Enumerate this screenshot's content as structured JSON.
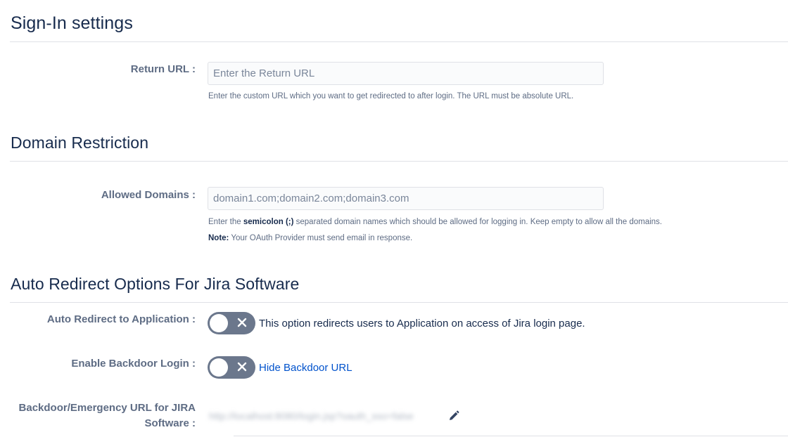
{
  "sign_in": {
    "title": "Sign-In settings",
    "return_url": {
      "label": "Return URL :",
      "placeholder": "Enter the Return URL",
      "value": "",
      "help": "Enter the custom URL which you want to get redirected to after login. The URL must be absolute URL."
    }
  },
  "domain_restriction": {
    "title": "Domain Restriction",
    "allowed_domains": {
      "label": "Allowed Domains :",
      "placeholder": "domain1.com;domain2.com;domain3.com",
      "value": "",
      "help_prefix": "Enter the ",
      "help_bold": "semicolon (;)",
      "help_suffix": " separated domain names which should be allowed for logging in. Keep empty to allow all the domains.",
      "note_label": "Note:",
      "note_text": " Your OAuth Provider must send email in response."
    }
  },
  "auto_redirect": {
    "title": "Auto Redirect Options For Jira Software",
    "auto_redirect_app": {
      "label": "Auto Redirect to Application :",
      "enabled": false,
      "description": "This option redirects users to Application on access of Jira login page."
    },
    "backdoor_login": {
      "label": "Enable Backdoor Login :",
      "enabled": false,
      "link": "Hide Backdoor URL"
    },
    "backdoor_url": {
      "label_line1": "Backdoor/Emergency URL for JIRA",
      "label_line2": "Software :",
      "value": "http://localhost:8080/login.jsp?oauth_sso=false"
    }
  },
  "icons": {
    "toggle_off": "close-icon",
    "edit": "pencil-icon"
  },
  "colors": {
    "heading": "#172b4d",
    "label": "#5e6c84",
    "link": "#0052cc",
    "toggle_off": "#6b778c"
  }
}
